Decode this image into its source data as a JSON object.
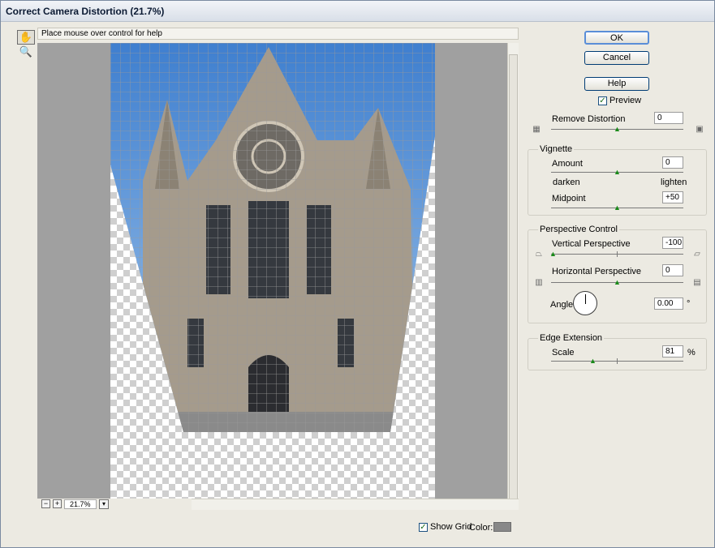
{
  "window": {
    "title": "Correct Camera Distortion (21.7%)"
  },
  "help_text": "Place mouse over control for help",
  "zoom": {
    "value": "21.7%"
  },
  "buttons": {
    "ok": "OK",
    "cancel": "Cancel",
    "help": "Help"
  },
  "preview": {
    "label": "Preview",
    "checked": true
  },
  "remove_distortion": {
    "label": "Remove Distortion",
    "value": "0"
  },
  "vignette": {
    "title": "Vignette",
    "amount_label": "Amount",
    "amount_value": "0",
    "darken_label": "darken",
    "lighten_label": "lighten",
    "midpoint_label": "Midpoint",
    "midpoint_value": "+50"
  },
  "perspective": {
    "title": "Perspective Control",
    "vertical_label": "Vertical Perspective",
    "vertical_value": "-100",
    "horizontal_label": "Horizontal Perspective",
    "horizontal_value": "0",
    "angle_label": "Angle:",
    "angle_value": "0.00",
    "angle_unit": "°"
  },
  "edge": {
    "title": "Edge Extension",
    "scale_label": "Scale",
    "scale_value": "81",
    "scale_unit": "%"
  },
  "grid": {
    "show_label": "Show Grid",
    "checked": true,
    "color_label": "Color:",
    "color": "#888888"
  },
  "colors": {
    "accent": "#5a8ed8",
    "knob": "#1a8a1a"
  },
  "icons": [
    "hand-icon",
    "zoom-icon",
    "pincushion-icon",
    "barrel-icon",
    "keystone-top-icon",
    "keystone-bottom-icon",
    "perspective-left-icon",
    "perspective-right-icon"
  ]
}
